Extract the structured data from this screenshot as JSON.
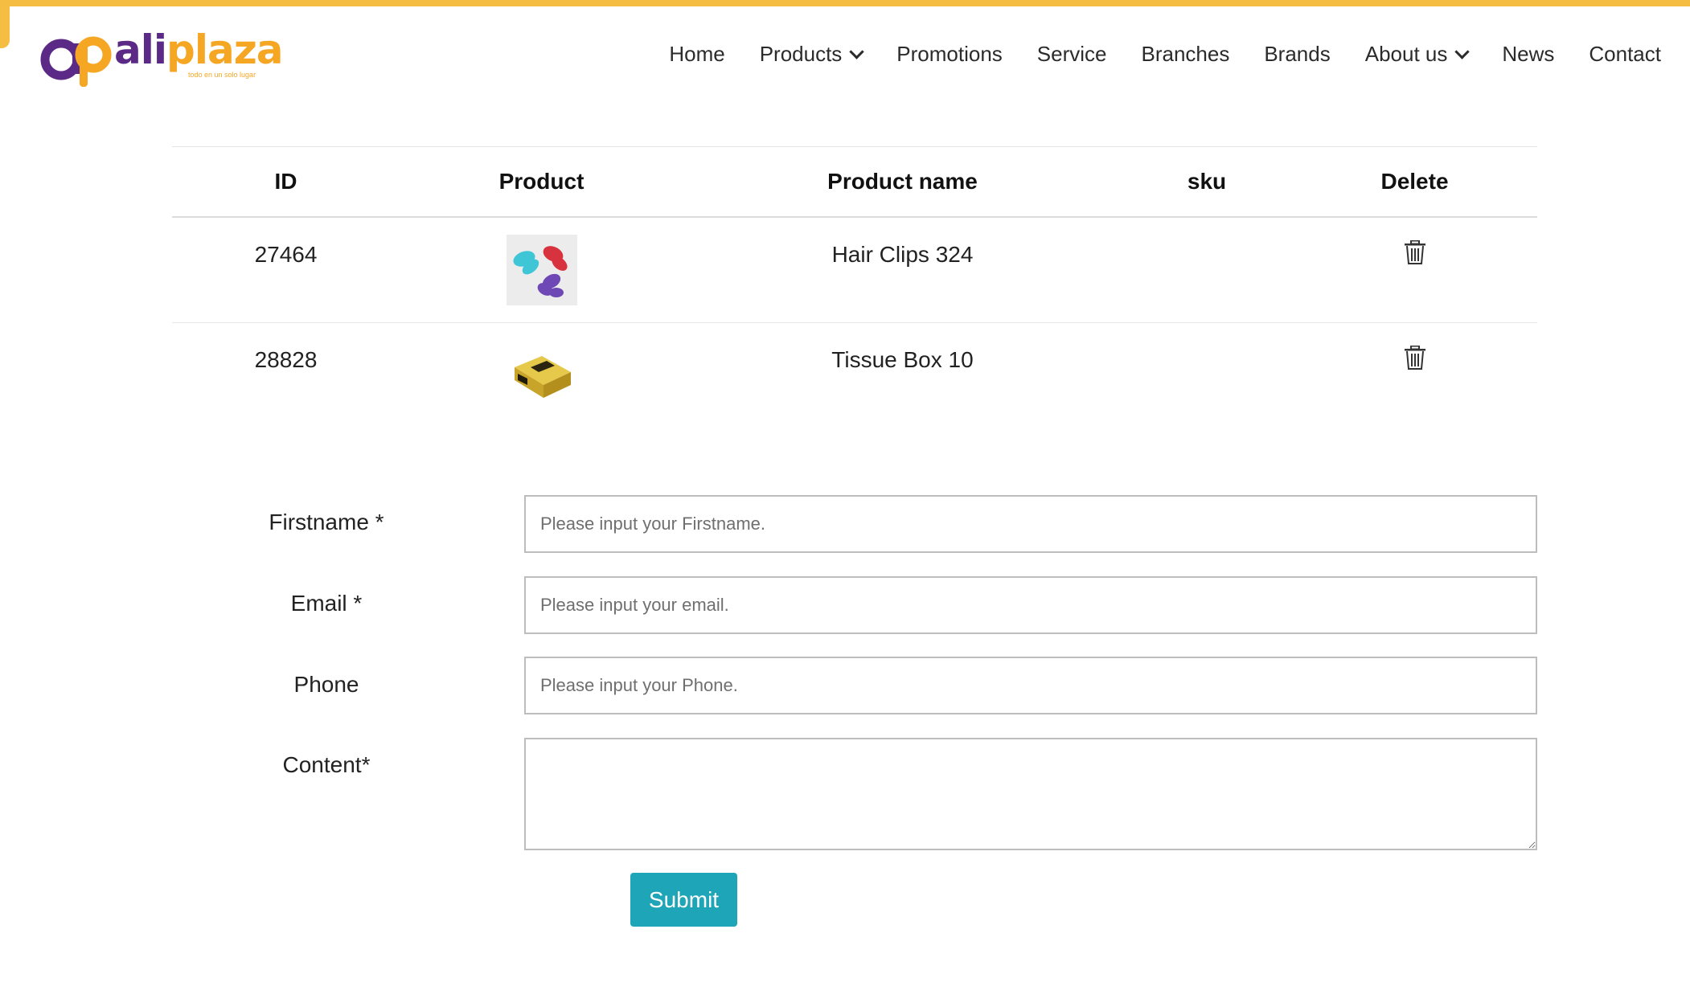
{
  "brand": {
    "name_part1": "ali",
    "name_part2": "plaza",
    "tagline": "todo en un solo lugar",
    "colors": {
      "purple": "#5b2a86",
      "orange": "#f5a623",
      "accent": "#f5bd42",
      "button": "#1ea5b8"
    }
  },
  "nav": {
    "items": [
      {
        "label": "Home",
        "has_dropdown": false
      },
      {
        "label": "Products",
        "has_dropdown": true
      },
      {
        "label": "Promotions",
        "has_dropdown": false
      },
      {
        "label": "Service",
        "has_dropdown": false
      },
      {
        "label": "Branches",
        "has_dropdown": false
      },
      {
        "label": "Brands",
        "has_dropdown": false
      },
      {
        "label": "About us",
        "has_dropdown": true
      },
      {
        "label": "News",
        "has_dropdown": false
      },
      {
        "label": "Contact",
        "has_dropdown": false
      }
    ]
  },
  "table": {
    "headers": [
      "ID",
      "Product",
      "Product name",
      "sku",
      "Delete"
    ],
    "rows": [
      {
        "id": "27464",
        "thumbnail": "hair-clips-image",
        "name": "Hair Clips 324",
        "sku": "",
        "delete_icon": "trash-icon"
      },
      {
        "id": "28828",
        "thumbnail": "tissue-box-image",
        "name": "Tissue Box 10",
        "sku": "",
        "delete_icon": "trash-icon"
      }
    ]
  },
  "form": {
    "firstname_label": "Firstname *",
    "firstname_placeholder": "Please input your Firstname.",
    "email_label": "Email *",
    "email_placeholder": "Please input your email.",
    "phone_label": "Phone",
    "phone_placeholder": "Please input your Phone.",
    "content_label": "Content*",
    "content_value": "",
    "submit_label": "Submit"
  }
}
